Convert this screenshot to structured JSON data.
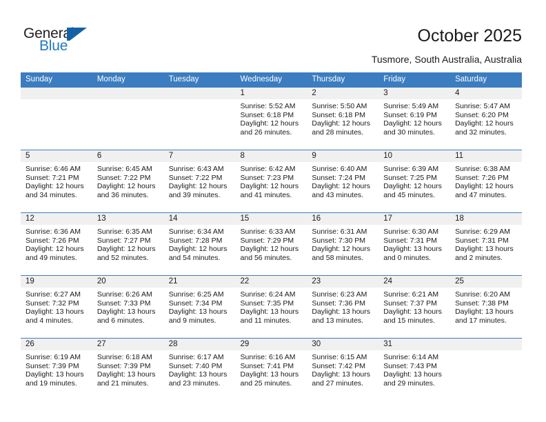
{
  "logo": {
    "word_one": "General",
    "word_two": "Blue",
    "mark": "triangle-flag",
    "colors": {
      "dark": "#231f20",
      "blue": "#2079c6",
      "mark": "#1462a5"
    }
  },
  "header": {
    "title": "October 2025",
    "location": "Tusmore, South Australia, Australia"
  },
  "theme": {
    "header_blue": "#3b7dc0",
    "band_gray": "#f0f0f0",
    "text": "#1a1a1a"
  },
  "calendar": {
    "weekday_headers": [
      "Sunday",
      "Monday",
      "Tuesday",
      "Wednesday",
      "Thursday",
      "Friday",
      "Saturday"
    ],
    "weeks": [
      [
        {
          "day": ""
        },
        {
          "day": ""
        },
        {
          "day": ""
        },
        {
          "day": "1",
          "sunrise": "Sunrise: 5:52 AM",
          "sunset": "Sunset: 6:18 PM",
          "daylight_1": "Daylight: 12 hours",
          "daylight_2": "and 26 minutes."
        },
        {
          "day": "2",
          "sunrise": "Sunrise: 5:50 AM",
          "sunset": "Sunset: 6:18 PM",
          "daylight_1": "Daylight: 12 hours",
          "daylight_2": "and 28 minutes."
        },
        {
          "day": "3",
          "sunrise": "Sunrise: 5:49 AM",
          "sunset": "Sunset: 6:19 PM",
          "daylight_1": "Daylight: 12 hours",
          "daylight_2": "and 30 minutes."
        },
        {
          "day": "4",
          "sunrise": "Sunrise: 5:47 AM",
          "sunset": "Sunset: 6:20 PM",
          "daylight_1": "Daylight: 12 hours",
          "daylight_2": "and 32 minutes."
        }
      ],
      [
        {
          "day": "5",
          "sunrise": "Sunrise: 6:46 AM",
          "sunset": "Sunset: 7:21 PM",
          "daylight_1": "Daylight: 12 hours",
          "daylight_2": "and 34 minutes."
        },
        {
          "day": "6",
          "sunrise": "Sunrise: 6:45 AM",
          "sunset": "Sunset: 7:22 PM",
          "daylight_1": "Daylight: 12 hours",
          "daylight_2": "and 36 minutes."
        },
        {
          "day": "7",
          "sunrise": "Sunrise: 6:43 AM",
          "sunset": "Sunset: 7:22 PM",
          "daylight_1": "Daylight: 12 hours",
          "daylight_2": "and 39 minutes."
        },
        {
          "day": "8",
          "sunrise": "Sunrise: 6:42 AM",
          "sunset": "Sunset: 7:23 PM",
          "daylight_1": "Daylight: 12 hours",
          "daylight_2": "and 41 minutes."
        },
        {
          "day": "9",
          "sunrise": "Sunrise: 6:40 AM",
          "sunset": "Sunset: 7:24 PM",
          "daylight_1": "Daylight: 12 hours",
          "daylight_2": "and 43 minutes."
        },
        {
          "day": "10",
          "sunrise": "Sunrise: 6:39 AM",
          "sunset": "Sunset: 7:25 PM",
          "daylight_1": "Daylight: 12 hours",
          "daylight_2": "and 45 minutes."
        },
        {
          "day": "11",
          "sunrise": "Sunrise: 6:38 AM",
          "sunset": "Sunset: 7:26 PM",
          "daylight_1": "Daylight: 12 hours",
          "daylight_2": "and 47 minutes."
        }
      ],
      [
        {
          "day": "12",
          "sunrise": "Sunrise: 6:36 AM",
          "sunset": "Sunset: 7:26 PM",
          "daylight_1": "Daylight: 12 hours",
          "daylight_2": "and 49 minutes."
        },
        {
          "day": "13",
          "sunrise": "Sunrise: 6:35 AM",
          "sunset": "Sunset: 7:27 PM",
          "daylight_1": "Daylight: 12 hours",
          "daylight_2": "and 52 minutes."
        },
        {
          "day": "14",
          "sunrise": "Sunrise: 6:34 AM",
          "sunset": "Sunset: 7:28 PM",
          "daylight_1": "Daylight: 12 hours",
          "daylight_2": "and 54 minutes."
        },
        {
          "day": "15",
          "sunrise": "Sunrise: 6:33 AM",
          "sunset": "Sunset: 7:29 PM",
          "daylight_1": "Daylight: 12 hours",
          "daylight_2": "and 56 minutes."
        },
        {
          "day": "16",
          "sunrise": "Sunrise: 6:31 AM",
          "sunset": "Sunset: 7:30 PM",
          "daylight_1": "Daylight: 12 hours",
          "daylight_2": "and 58 minutes."
        },
        {
          "day": "17",
          "sunrise": "Sunrise: 6:30 AM",
          "sunset": "Sunset: 7:31 PM",
          "daylight_1": "Daylight: 13 hours",
          "daylight_2": "and 0 minutes."
        },
        {
          "day": "18",
          "sunrise": "Sunrise: 6:29 AM",
          "sunset": "Sunset: 7:31 PM",
          "daylight_1": "Daylight: 13 hours",
          "daylight_2": "and 2 minutes."
        }
      ],
      [
        {
          "day": "19",
          "sunrise": "Sunrise: 6:27 AM",
          "sunset": "Sunset: 7:32 PM",
          "daylight_1": "Daylight: 13 hours",
          "daylight_2": "and 4 minutes."
        },
        {
          "day": "20",
          "sunrise": "Sunrise: 6:26 AM",
          "sunset": "Sunset: 7:33 PM",
          "daylight_1": "Daylight: 13 hours",
          "daylight_2": "and 6 minutes."
        },
        {
          "day": "21",
          "sunrise": "Sunrise: 6:25 AM",
          "sunset": "Sunset: 7:34 PM",
          "daylight_1": "Daylight: 13 hours",
          "daylight_2": "and 9 minutes."
        },
        {
          "day": "22",
          "sunrise": "Sunrise: 6:24 AM",
          "sunset": "Sunset: 7:35 PM",
          "daylight_1": "Daylight: 13 hours",
          "daylight_2": "and 11 minutes."
        },
        {
          "day": "23",
          "sunrise": "Sunrise: 6:23 AM",
          "sunset": "Sunset: 7:36 PM",
          "daylight_1": "Daylight: 13 hours",
          "daylight_2": "and 13 minutes."
        },
        {
          "day": "24",
          "sunrise": "Sunrise: 6:21 AM",
          "sunset": "Sunset: 7:37 PM",
          "daylight_1": "Daylight: 13 hours",
          "daylight_2": "and 15 minutes."
        },
        {
          "day": "25",
          "sunrise": "Sunrise: 6:20 AM",
          "sunset": "Sunset: 7:38 PM",
          "daylight_1": "Daylight: 13 hours",
          "daylight_2": "and 17 minutes."
        }
      ],
      [
        {
          "day": "26",
          "sunrise": "Sunrise: 6:19 AM",
          "sunset": "Sunset: 7:39 PM",
          "daylight_1": "Daylight: 13 hours",
          "daylight_2": "and 19 minutes."
        },
        {
          "day": "27",
          "sunrise": "Sunrise: 6:18 AM",
          "sunset": "Sunset: 7:39 PM",
          "daylight_1": "Daylight: 13 hours",
          "daylight_2": "and 21 minutes."
        },
        {
          "day": "28",
          "sunrise": "Sunrise: 6:17 AM",
          "sunset": "Sunset: 7:40 PM",
          "daylight_1": "Daylight: 13 hours",
          "daylight_2": "and 23 minutes."
        },
        {
          "day": "29",
          "sunrise": "Sunrise: 6:16 AM",
          "sunset": "Sunset: 7:41 PM",
          "daylight_1": "Daylight: 13 hours",
          "daylight_2": "and 25 minutes."
        },
        {
          "day": "30",
          "sunrise": "Sunrise: 6:15 AM",
          "sunset": "Sunset: 7:42 PM",
          "daylight_1": "Daylight: 13 hours",
          "daylight_2": "and 27 minutes."
        },
        {
          "day": "31",
          "sunrise": "Sunrise: 6:14 AM",
          "sunset": "Sunset: 7:43 PM",
          "daylight_1": "Daylight: 13 hours",
          "daylight_2": "and 29 minutes."
        },
        {
          "day": ""
        }
      ]
    ]
  }
}
